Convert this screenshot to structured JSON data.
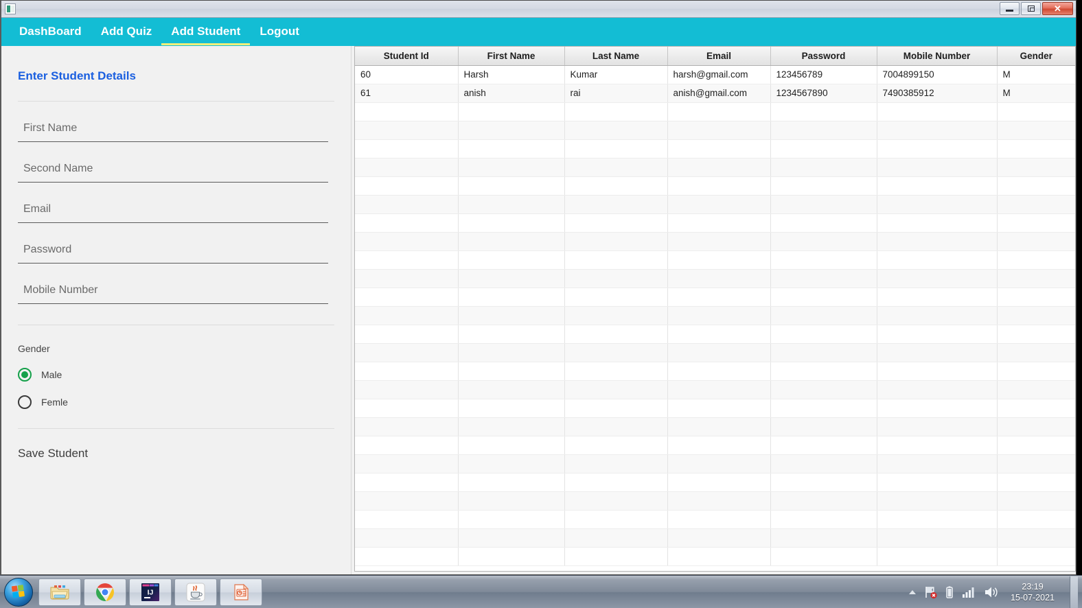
{
  "window": {
    "app_icon": "java-app-icon",
    "controls": {
      "minimize": "Minimize",
      "restore": "Restore",
      "close": "✕"
    }
  },
  "navbar": {
    "items": [
      {
        "label": "DashBoard",
        "active": false
      },
      {
        "label": "Add Quiz",
        "active": false
      },
      {
        "label": "Add Student",
        "active": true
      },
      {
        "label": "Logout",
        "active": false
      }
    ],
    "background_color": "#13bdd4",
    "active_underline_color": "#f0f07a"
  },
  "form": {
    "title": "Enter Student Details",
    "title_color": "#1a5fe0",
    "fields": [
      {
        "name": "first-name",
        "placeholder": "First Name",
        "value": ""
      },
      {
        "name": "second-name",
        "placeholder": "Second Name",
        "value": ""
      },
      {
        "name": "email",
        "placeholder": "Email",
        "value": ""
      },
      {
        "name": "password",
        "placeholder": "Password",
        "value": ""
      },
      {
        "name": "mobile-number",
        "placeholder": "Mobile Number",
        "value": ""
      }
    ],
    "gender": {
      "label": "Gender",
      "selected": "Male",
      "options": [
        {
          "label": "Male",
          "checked": true
        },
        {
          "label": "Femle",
          "checked": false
        }
      ],
      "accent_color": "#15a04a"
    },
    "save_button": "Save Student"
  },
  "table": {
    "columns": [
      "Student Id",
      "First Name",
      "Last Name",
      "Email",
      "Password",
      "Mobile Number",
      "Gender"
    ],
    "rows": [
      [
        "60",
        "Harsh",
        "Kumar",
        "harsh@gmail.com",
        "123456789",
        "7004899150",
        "M"
      ],
      [
        "61",
        "anish",
        "rai",
        "anish@gmail.com",
        "1234567890",
        "7490385912",
        "M"
      ]
    ],
    "empty_row_count": 25
  },
  "taskbar": {
    "start_button": "start-orb",
    "tasks": [
      {
        "name": "file-explorer",
        "icon": "folder-icon"
      },
      {
        "name": "google-chrome",
        "icon": "chrome-icon"
      },
      {
        "name": "intellij-idea",
        "icon": "intellij-icon",
        "label": "IJ"
      },
      {
        "name": "java-application",
        "icon": "java-coffee-icon"
      },
      {
        "name": "powerpoint",
        "icon": "powerpoint-icon"
      }
    ],
    "tray": [
      {
        "name": "show-hidden-icons",
        "icon": "chevron-up-icon"
      },
      {
        "name": "action-center",
        "icon": "flag-alert-icon"
      },
      {
        "name": "battery",
        "icon": "battery-icon"
      },
      {
        "name": "network",
        "icon": "signal-bars-icon"
      },
      {
        "name": "volume",
        "icon": "speaker-icon"
      }
    ],
    "clock": {
      "time": "23:19",
      "date": "15-07-2021"
    }
  }
}
